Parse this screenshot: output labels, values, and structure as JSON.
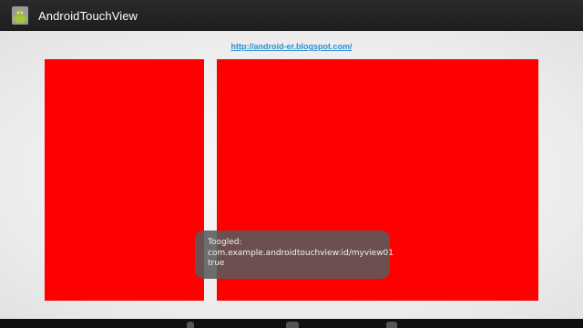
{
  "action_bar": {
    "title": "AndroidTouchView",
    "icon": "android-robot-icon",
    "background": "#222222"
  },
  "main": {
    "link_text": "http://android-er.blogspot.com/",
    "views": [
      {
        "id": "myview01",
        "color": "#ff0000"
      },
      {
        "id": "myview02",
        "color": "#ff0000"
      }
    ]
  },
  "toast": {
    "line1": "Toogled:",
    "line2": "com.example.androidtouchview:id/myview01",
    "line3": "true"
  },
  "nav_bar": {
    "buttons": [
      "back-icon",
      "home-icon",
      "recents-icon"
    ]
  }
}
